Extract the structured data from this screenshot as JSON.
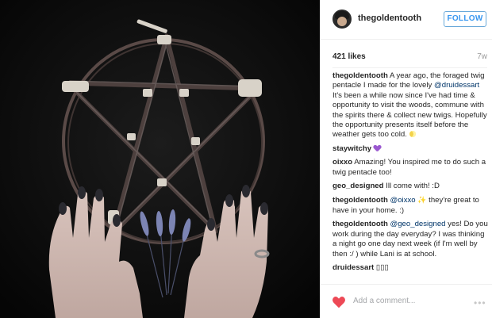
{
  "post": {
    "username": "thegoldentooth",
    "follow_label": "FOLLOW",
    "likes": "421 likes",
    "age": "7w"
  },
  "comments": [
    {
      "author": "thegoldentooth",
      "text": " A year ago, the foraged twig pentacle I made for the lovely ",
      "mention": "@druidessart",
      "text2": "It's been a while now since I've had time & opportunity to visit the woods, commune with the spirits there & collect new twigs. Hopefully the opportunity presents itself before the weather gets too cold. "
    },
    {
      "author": "staywitchy",
      "text": " "
    },
    {
      "author": "oixxo",
      "text": " Amazing! You inspired me to do such a twig pentacle too!"
    },
    {
      "author": "geo_designed",
      "text": " Ill come with! :D"
    },
    {
      "author": "thegoldentooth",
      "mention": "@oixxo",
      "sparkle": "✨",
      "text": " they're great to have in your home. :)"
    },
    {
      "author": "thegoldentooth",
      "mention": "@geo_designed",
      "text": " yes! Do you work during the day everyday? I was thinking a night go one day next week (if I'm well by then :/ ) while Lani is at school."
    },
    {
      "author": "druidessart",
      "text": " ▯▯▯"
    }
  ],
  "footer": {
    "add_comment_placeholder": "Add a comment...",
    "more_label": "•••"
  },
  "colors": {
    "accent": "#3897f0",
    "like_red": "#ed4956",
    "mention": "#003569",
    "photo_bg": "#0b0b0b"
  },
  "icons": {
    "like": "heart-icon",
    "more": "more-options-icon",
    "emoji_moon": "moon-emoji-icon",
    "emoji_heart": "purple-heart-emoji-icon"
  }
}
